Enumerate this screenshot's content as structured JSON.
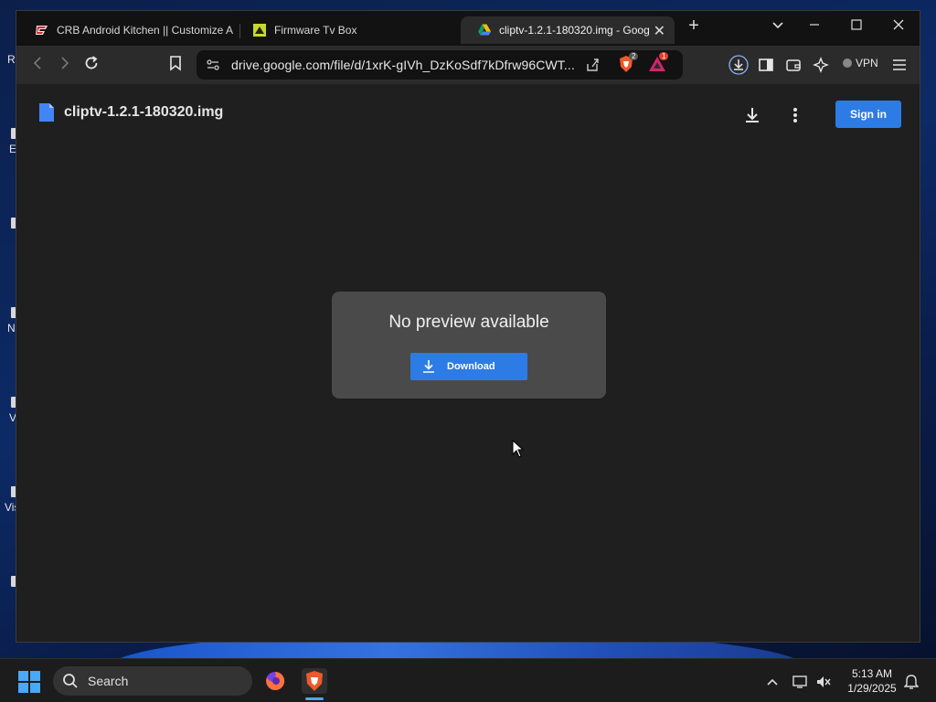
{
  "desktop": {
    "partial_labels": [
      "R",
      "E",
      "N",
      "V",
      "Vis"
    ]
  },
  "browser": {
    "tabs": [
      {
        "title": "CRB Android Kitchen || Customize A",
        "active": false
      },
      {
        "title": "Firmware Tv Box",
        "active": false
      },
      {
        "title": "cliptv-1.2.1-180320.img - Goog",
        "active": true
      }
    ],
    "new_tab_symbol": "+",
    "address": "drive.google.com/file/d/1xrK-gIVh_DzKoSdf7kDfrw96CWT...",
    "brave_shield_count": "2",
    "rewards_badge": "1",
    "vpn_label": "VPN"
  },
  "page": {
    "file_name": "cliptv-1.2.1-180320.img",
    "sign_in_label": "Sign in",
    "preview_message": "No preview available",
    "download_label": "Download"
  },
  "taskbar": {
    "search_placeholder": "Search",
    "time": "5:13 AM",
    "date": "1/29/2025"
  },
  "colors": {
    "accent_blue": "#2d7be5",
    "window_bg": "#1f1f1f",
    "card_bg": "#4a4a4a"
  }
}
